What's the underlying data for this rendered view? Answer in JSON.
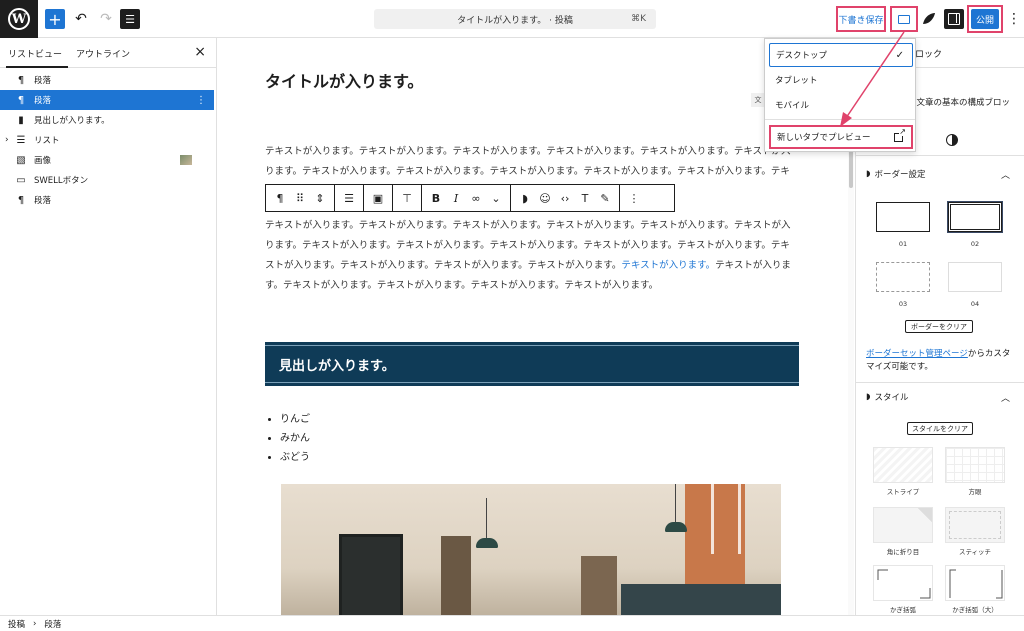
{
  "topbar": {
    "command_bar_text": "タイトルが入ります。 · 投稿",
    "command_shortcut": "⌘K",
    "save_draft_label": "下書き保存",
    "publish_label": "公開"
  },
  "left_panel": {
    "tab_list_view": "リストビュー",
    "tab_outline": "アウトライン",
    "items": [
      {
        "icon": "paragraph-icon",
        "label": "段落"
      },
      {
        "icon": "paragraph-icon",
        "label": "段落"
      },
      {
        "icon": "bookmark-icon",
        "label": "見出しが入ります。"
      },
      {
        "icon": "list-icon",
        "label": "リスト"
      },
      {
        "icon": "image-icon",
        "label": "画像"
      },
      {
        "icon": "button-icon",
        "label": "SWELLボタン"
      },
      {
        "icon": "paragraph-icon",
        "label": "段落"
      }
    ]
  },
  "editor": {
    "title": "タイトルが入ります。",
    "chip": "文",
    "para1": "テキストが入ります。テキストが入ります。テキストが入ります。テキストが入ります。テキストが入ります。テキストが入ります。テキストが入ります。テキストが入ります。テキストが入ります。テキストが入ります。テキストが入ります。テキストが入ります。テキストが入ります。テキストが入ります。テキストが入ります。",
    "para2_before": "テキストが入ります。テキストが入ります。テキストが入ります。テキストが入ります。テキストが入ります。テキストが入ります。テキストが入ります。テキストが入ります。テキストが入ります。テキストが入ります。テキストが入ります。テキストが入ります。テキストが入ります。テキストが入ります。テキストが入ります。",
    "para2_link": "テキストが入ります。",
    "para2_after": "テキストが入ります。テキストが入ります。テキストが入ります。テキストが入ります。テキストが入ります。",
    "heading": "見出しが入ります。",
    "list_items": [
      "りんご",
      "みかん",
      "ぶどう"
    ]
  },
  "dropdown": {
    "desktop": "デスクトップ",
    "tablet": "タブレット",
    "mobile": "モバイル",
    "preview_new_tab": "新しいタブでプレビュー"
  },
  "right_panel": {
    "tab_text": "ロック",
    "description": "り文章の基本の構成ブロッ",
    "border_section": "ボーダー設定",
    "border_options": [
      "01",
      "02",
      "03",
      "04"
    ],
    "clear_border": "ボーダーをクリア",
    "link_text": "ボーダーセット管理ページ",
    "link_suffix": "からカスタマイズ可能です。",
    "style_section": "スタイル",
    "clear_style": "スタイルをクリア",
    "style_options": [
      "ストライプ",
      "方眼",
      "角に折り目",
      "スティッチ",
      "かぎ括弧",
      "かぎ括弧（大）"
    ]
  },
  "footer": {
    "crumb1": "投稿",
    "separator": "›",
    "crumb2": "段落"
  },
  "colors": {
    "accent": "#1e75d3",
    "highlight": "#e0436b",
    "heading_bg": "#0f3b57"
  }
}
